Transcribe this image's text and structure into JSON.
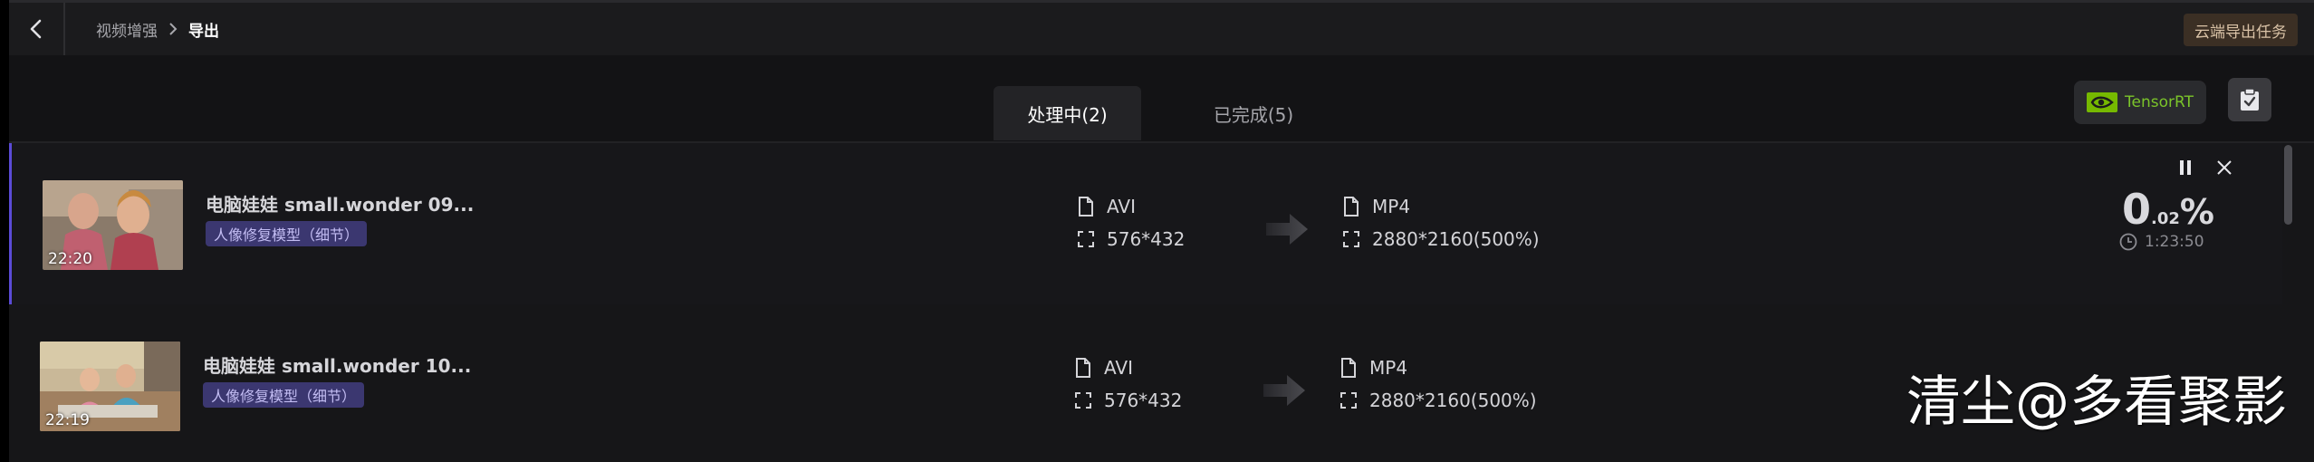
{
  "topbar": {
    "breadcrumb_parent": "视频增强",
    "breadcrumb_current": "导出",
    "cloud_export_label": "云端导出任务"
  },
  "tabs": [
    {
      "label": "处理中(2)",
      "active": true
    },
    {
      "label": "已完成(5)",
      "active": false
    }
  ],
  "tensorrt_label": "TensorRT",
  "tasks": [
    {
      "title": "电脑娃娃 small.wonder 09...",
      "duration": "22:20",
      "model_tag": "人像修复模型（细节）",
      "source_format": "AVI",
      "source_resolution": "576*432",
      "target_format": "MP4",
      "target_resolution": "2880*2160(500%)",
      "progress_int": "0",
      "progress_dec": ".02",
      "progress_sym": "%",
      "time_remaining": "1:23:50"
    },
    {
      "title": "电脑娃娃 small.wonder 10...",
      "duration": "22:19",
      "model_tag": "人像修复模型（细节）",
      "source_format": "AVI",
      "source_resolution": "576*432",
      "target_format": "MP4",
      "target_resolution": "2880*2160(500%)"
    }
  ],
  "watermark": "清尘@多看聚影",
  "colors": {
    "accent_purple": "#5b4bd6",
    "tag_bg": "#3b3770",
    "nvidia_green": "#76b900",
    "cloud_btn_bg": "#3b2f24"
  }
}
